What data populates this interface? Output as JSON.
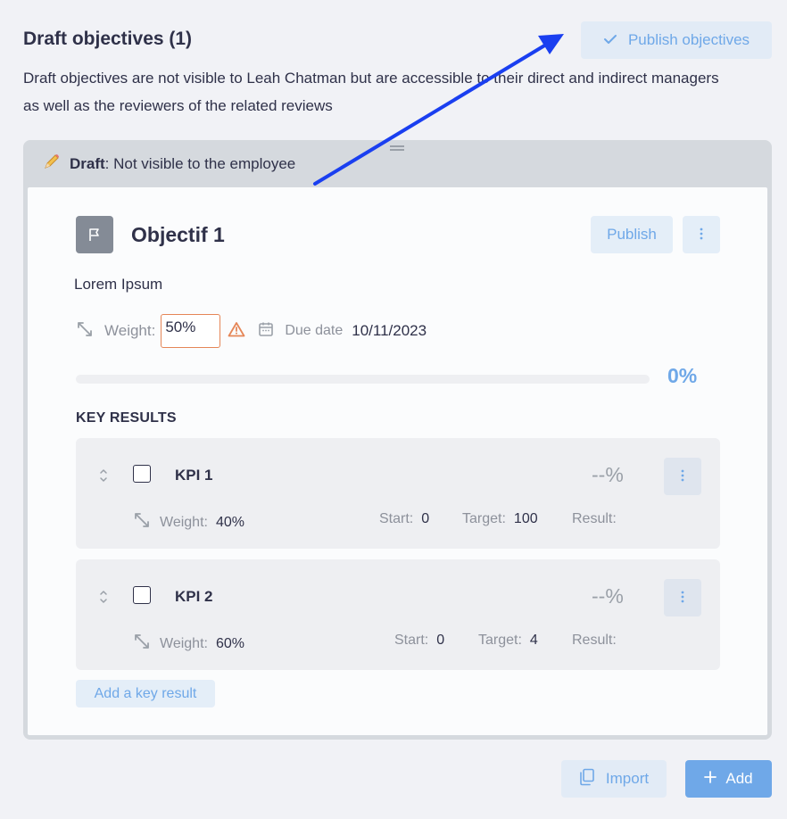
{
  "header": {
    "title": "Draft objectives (1)",
    "publish_all_label": "Publish objectives",
    "description": "Draft objectives are not visible to Leah Chatman but are accessible to their direct and indirect managers as well as the reviewers of the related reviews"
  },
  "draft_banner": {
    "strong": "Draft",
    "text": ": Not visible to the employee"
  },
  "objective": {
    "title": "Objectif 1",
    "publish_label": "Publish",
    "description": "Lorem Ipsum",
    "weight_label": "Weight:",
    "weight_value": "50%",
    "due_label": "Due date",
    "due_value": "10/11/2023",
    "progress_pct": "0%",
    "progress_fraction": 0
  },
  "key_results": {
    "heading": "KEY RESULTS",
    "items": [
      {
        "name": "KPI 1",
        "pct": "--%",
        "weight_label": "Weight:",
        "weight": "40%",
        "start_label": "Start:",
        "start": "0",
        "target_label": "Target:",
        "target": "100",
        "result_label": "Result:"
      },
      {
        "name": "KPI 2",
        "pct": "--%",
        "weight_label": "Weight:",
        "weight": "60%",
        "start_label": "Start:",
        "start": "0",
        "target_label": "Target:",
        "target": "4",
        "result_label": "Result:"
      }
    ],
    "add_label": "Add a key result"
  },
  "footer": {
    "import_label": "Import",
    "add_label": "Add"
  },
  "colors": {
    "accent": "#6fa8e8",
    "warning": "#e58657",
    "annotation_arrow": "#1a3ff0"
  },
  "icons": [
    "check-icon",
    "pencil-icon",
    "flag-icon",
    "more-vertical-icon",
    "resize-icon",
    "warning-icon",
    "calendar-icon",
    "sort-icon",
    "import-icon",
    "plus-icon"
  ]
}
